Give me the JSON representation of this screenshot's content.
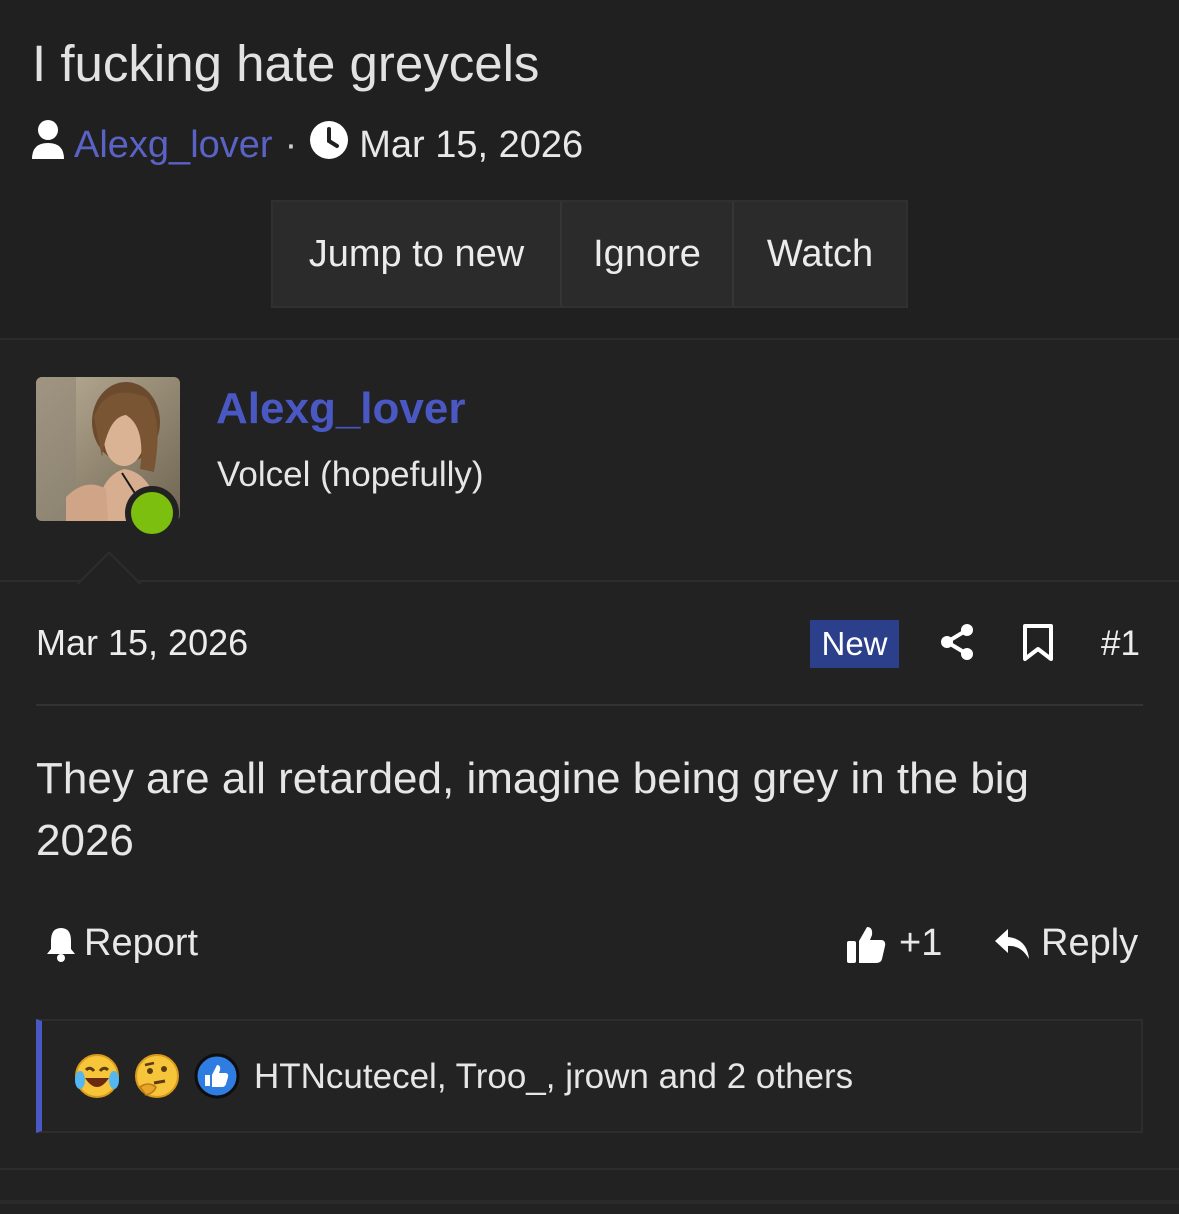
{
  "thread": {
    "title": "I fucking hate greycels",
    "author": "Alexg_lover",
    "separator": "·",
    "date": "Mar 15, 2026"
  },
  "toolbar": {
    "jump_label": "Jump to new",
    "ignore_label": "Ignore",
    "watch_label": "Watch"
  },
  "user": {
    "name": "Alexg_lover",
    "title": "Volcel (hopefully)",
    "status": "online"
  },
  "post": {
    "date": "Mar 15, 2026",
    "badge": "New",
    "number": "#1",
    "body": "They are all retarded, imagine being grey in the big 2026"
  },
  "actions": {
    "report_label": "Report",
    "like_label": "+1",
    "reply_label": "Reply"
  },
  "reactions": {
    "icons": [
      "laughing-crying-emoji",
      "thinking-emoji",
      "like-emoji"
    ],
    "text": "HTNcutecel, Troo_, jrown and 2 others"
  },
  "colors": {
    "background": "#222222",
    "accent": "#4a58c4",
    "badge": "#2b3f8a",
    "online": "#7dbf0e"
  }
}
